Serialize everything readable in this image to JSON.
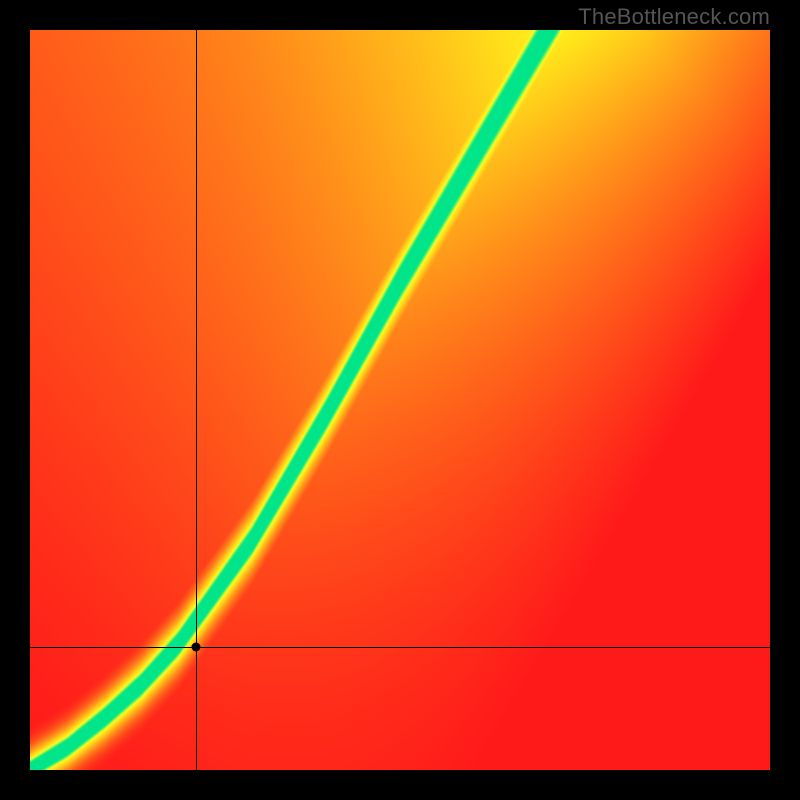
{
  "attribution": "TheBottleneck.com",
  "chart_data": {
    "type": "heatmap",
    "title": "",
    "xlabel": "",
    "ylabel": "",
    "xlim": [
      0,
      1
    ],
    "ylim": [
      0,
      1
    ],
    "marker": {
      "x": 0.225,
      "y": 0.165
    },
    "optimal_curve": {
      "description": "Green optimal band; approximate (x,y) centerline in normalized 0–1 coords",
      "points": [
        [
          0.0,
          0.0
        ],
        [
          0.05,
          0.03
        ],
        [
          0.1,
          0.07
        ],
        [
          0.15,
          0.115
        ],
        [
          0.2,
          0.17
        ],
        [
          0.25,
          0.24
        ],
        [
          0.3,
          0.31
        ],
        [
          0.35,
          0.395
        ],
        [
          0.4,
          0.48
        ],
        [
          0.45,
          0.57
        ],
        [
          0.5,
          0.66
        ],
        [
          0.55,
          0.745
        ],
        [
          0.6,
          0.83
        ],
        [
          0.65,
          0.915
        ],
        [
          0.7,
          1.0
        ]
      ],
      "band_halfwidth": 0.028
    },
    "gradient_corners": {
      "note": "approximate perceived corner colors",
      "bottom_left": "#ff1a1a",
      "bottom_right": "#ff1a1a",
      "top_left": "#ff1a1a",
      "top_right": "#ffff33"
    },
    "color_scale": [
      {
        "t": 0.0,
        "color": "#ff1a1a"
      },
      {
        "t": 0.4,
        "color": "#ff8c1a"
      },
      {
        "t": 0.7,
        "color": "#ffe61a"
      },
      {
        "t": 0.83,
        "color": "#ffff33"
      },
      {
        "t": 0.92,
        "color": "#c8ff33"
      },
      {
        "t": 1.0,
        "color": "#00e58a"
      }
    ]
  }
}
